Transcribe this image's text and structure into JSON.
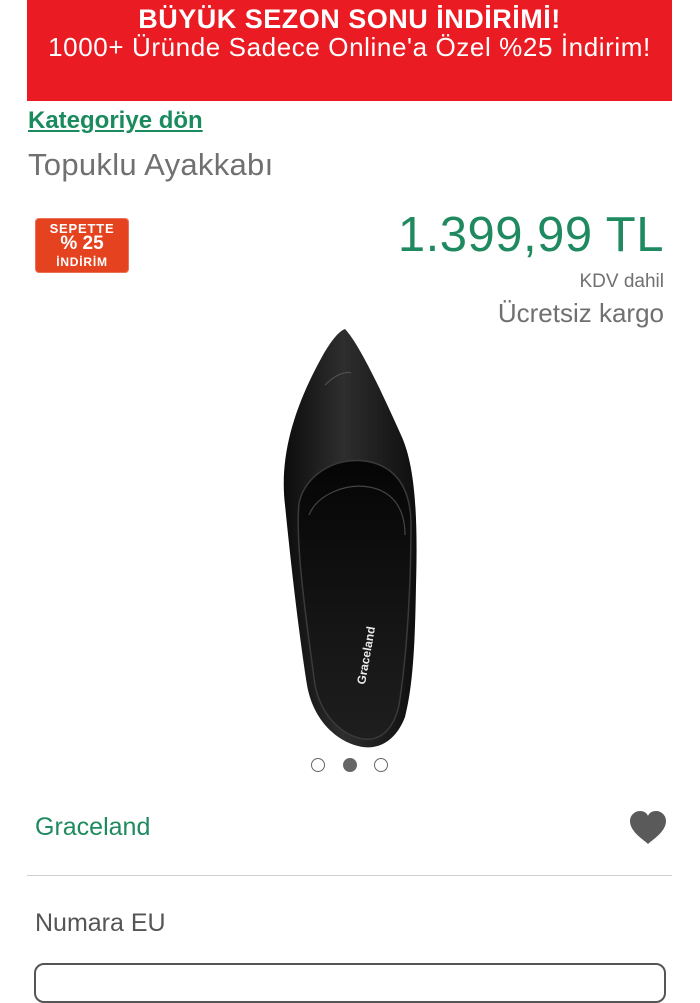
{
  "promo_banner": {
    "title": "BÜYÜK SEZON SONU İNDİRİMİ!",
    "subtitle": "1000+ Üründe Sadece Online'a Özel %25 İndirim!",
    "background": "#ea1b22"
  },
  "navigation": {
    "back_link": "Kategoriye dön"
  },
  "product": {
    "title": "Topuklu Ayakkabı",
    "badge": {
      "line1": "SEPETTE",
      "line2": "% 25",
      "line3": "İNDİRİM",
      "color": "#e5431f"
    },
    "price": "1.399,99 TL",
    "vat_note": "KDV dahil",
    "shipping": "Ücretsiz kargo",
    "image_brand_text": "Graceland",
    "gallery": {
      "count": 3,
      "active_index": 1
    },
    "brand": "Graceland",
    "favorite_icon": "heart-icon"
  },
  "size_selector": {
    "label": "Numara EU"
  },
  "colors": {
    "accent_green": "#1f8a60",
    "link_green": "#1a8a5f",
    "muted_text": "#707070"
  }
}
